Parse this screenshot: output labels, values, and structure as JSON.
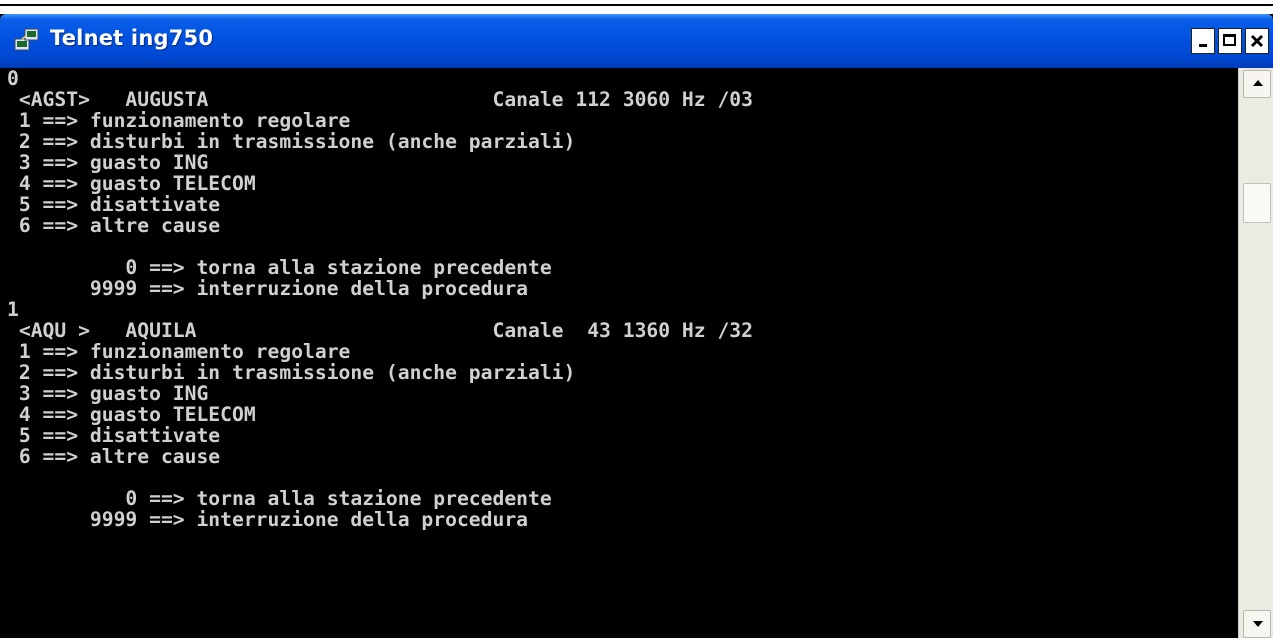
{
  "window": {
    "title": "Telnet ing750",
    "icon": "telnet-app-icon"
  },
  "colors": {
    "titlebar": "#0053e0",
    "console_bg": "#000000",
    "console_text": "#d0d0d0"
  },
  "console": {
    "lines": [
      "0",
      " <AGST>   AUGUSTA                        Canale 112 3060 Hz /03",
      " 1 ==> funzionamento regolare",
      " 2 ==> disturbi in trasmissione (anche parziali)",
      " 3 ==> guasto ING",
      " 4 ==> guasto TELECOM",
      " 5 ==> disattivate",
      " 6 ==> altre cause",
      "",
      "          0 ==> torna alla stazione precedente",
      "       9999 ==> interruzione della procedura",
      "1",
      " <AQU >   AQUILA                         Canale  43 1360 Hz /32",
      " 1 ==> funzionamento regolare",
      " 2 ==> disturbi in trasmissione (anche parziali)",
      " 3 ==> guasto ING",
      " 4 ==> guasto TELECOM",
      " 5 ==> disattivate",
      " 6 ==> altre cause",
      "",
      "          0 ==> torna alla stazione precedente",
      "       9999 ==> interruzione della procedura"
    ]
  },
  "scrollbar": {
    "position_fraction": 0.18
  }
}
